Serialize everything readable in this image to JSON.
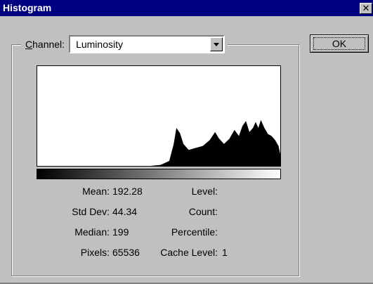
{
  "window": {
    "title": "Histogram",
    "close_glyph": "✕"
  },
  "channel": {
    "label_prefix": "",
    "label_accel": "C",
    "label_rest": "hannel:",
    "value": "Luminosity"
  },
  "ok_button": {
    "label": "OK"
  },
  "stats_left": [
    {
      "label": "Mean:",
      "value": "192.28"
    },
    {
      "label": "Std Dev:",
      "value": "44.34"
    },
    {
      "label": "Median:",
      "value": "199"
    },
    {
      "label": "Pixels:",
      "value": "65536"
    }
  ],
  "stats_right": [
    {
      "label": "Level:",
      "value": ""
    },
    {
      "label": "Count:",
      "value": ""
    },
    {
      "label": "Percentile:",
      "value": ""
    },
    {
      "label": "Cache Level:",
      "value": "1"
    }
  ],
  "histogram": {
    "fill_color": "#000000",
    "background": "#ffffff",
    "levels": [
      {
        "level": 0,
        "count": 0.0
      },
      {
        "level": 128,
        "count": 0.0
      },
      {
        "level": 140,
        "count": 0.01
      },
      {
        "level": 150,
        "count": 0.05
      },
      {
        "level": 155,
        "count": 0.22
      },
      {
        "level": 158,
        "count": 0.38
      },
      {
        "level": 162,
        "count": 0.33
      },
      {
        "level": 166,
        "count": 0.22
      },
      {
        "level": 172,
        "count": 0.16
      },
      {
        "level": 180,
        "count": 0.18
      },
      {
        "level": 188,
        "count": 0.2
      },
      {
        "level": 196,
        "count": 0.26
      },
      {
        "level": 202,
        "count": 0.34
      },
      {
        "level": 206,
        "count": 0.28
      },
      {
        "level": 212,
        "count": 0.22
      },
      {
        "level": 218,
        "count": 0.27
      },
      {
        "level": 224,
        "count": 0.36
      },
      {
        "level": 229,
        "count": 0.3
      },
      {
        "level": 233,
        "count": 0.4
      },
      {
        "level": 237,
        "count": 0.45
      },
      {
        "level": 241,
        "count": 0.34
      },
      {
        "level": 245,
        "count": 0.38
      },
      {
        "level": 248,
        "count": 0.44
      },
      {
        "level": 251,
        "count": 0.38
      },
      {
        "level": 254,
        "count": 0.46
      },
      {
        "level": 258,
        "count": 0.38
      },
      {
        "level": 262,
        "count": 0.32
      },
      {
        "level": 266,
        "count": 0.3
      },
      {
        "level": 270,
        "count": 0.26
      },
      {
        "level": 274,
        "count": 0.2
      },
      {
        "level": 276,
        "count": 0.12
      }
    ]
  }
}
